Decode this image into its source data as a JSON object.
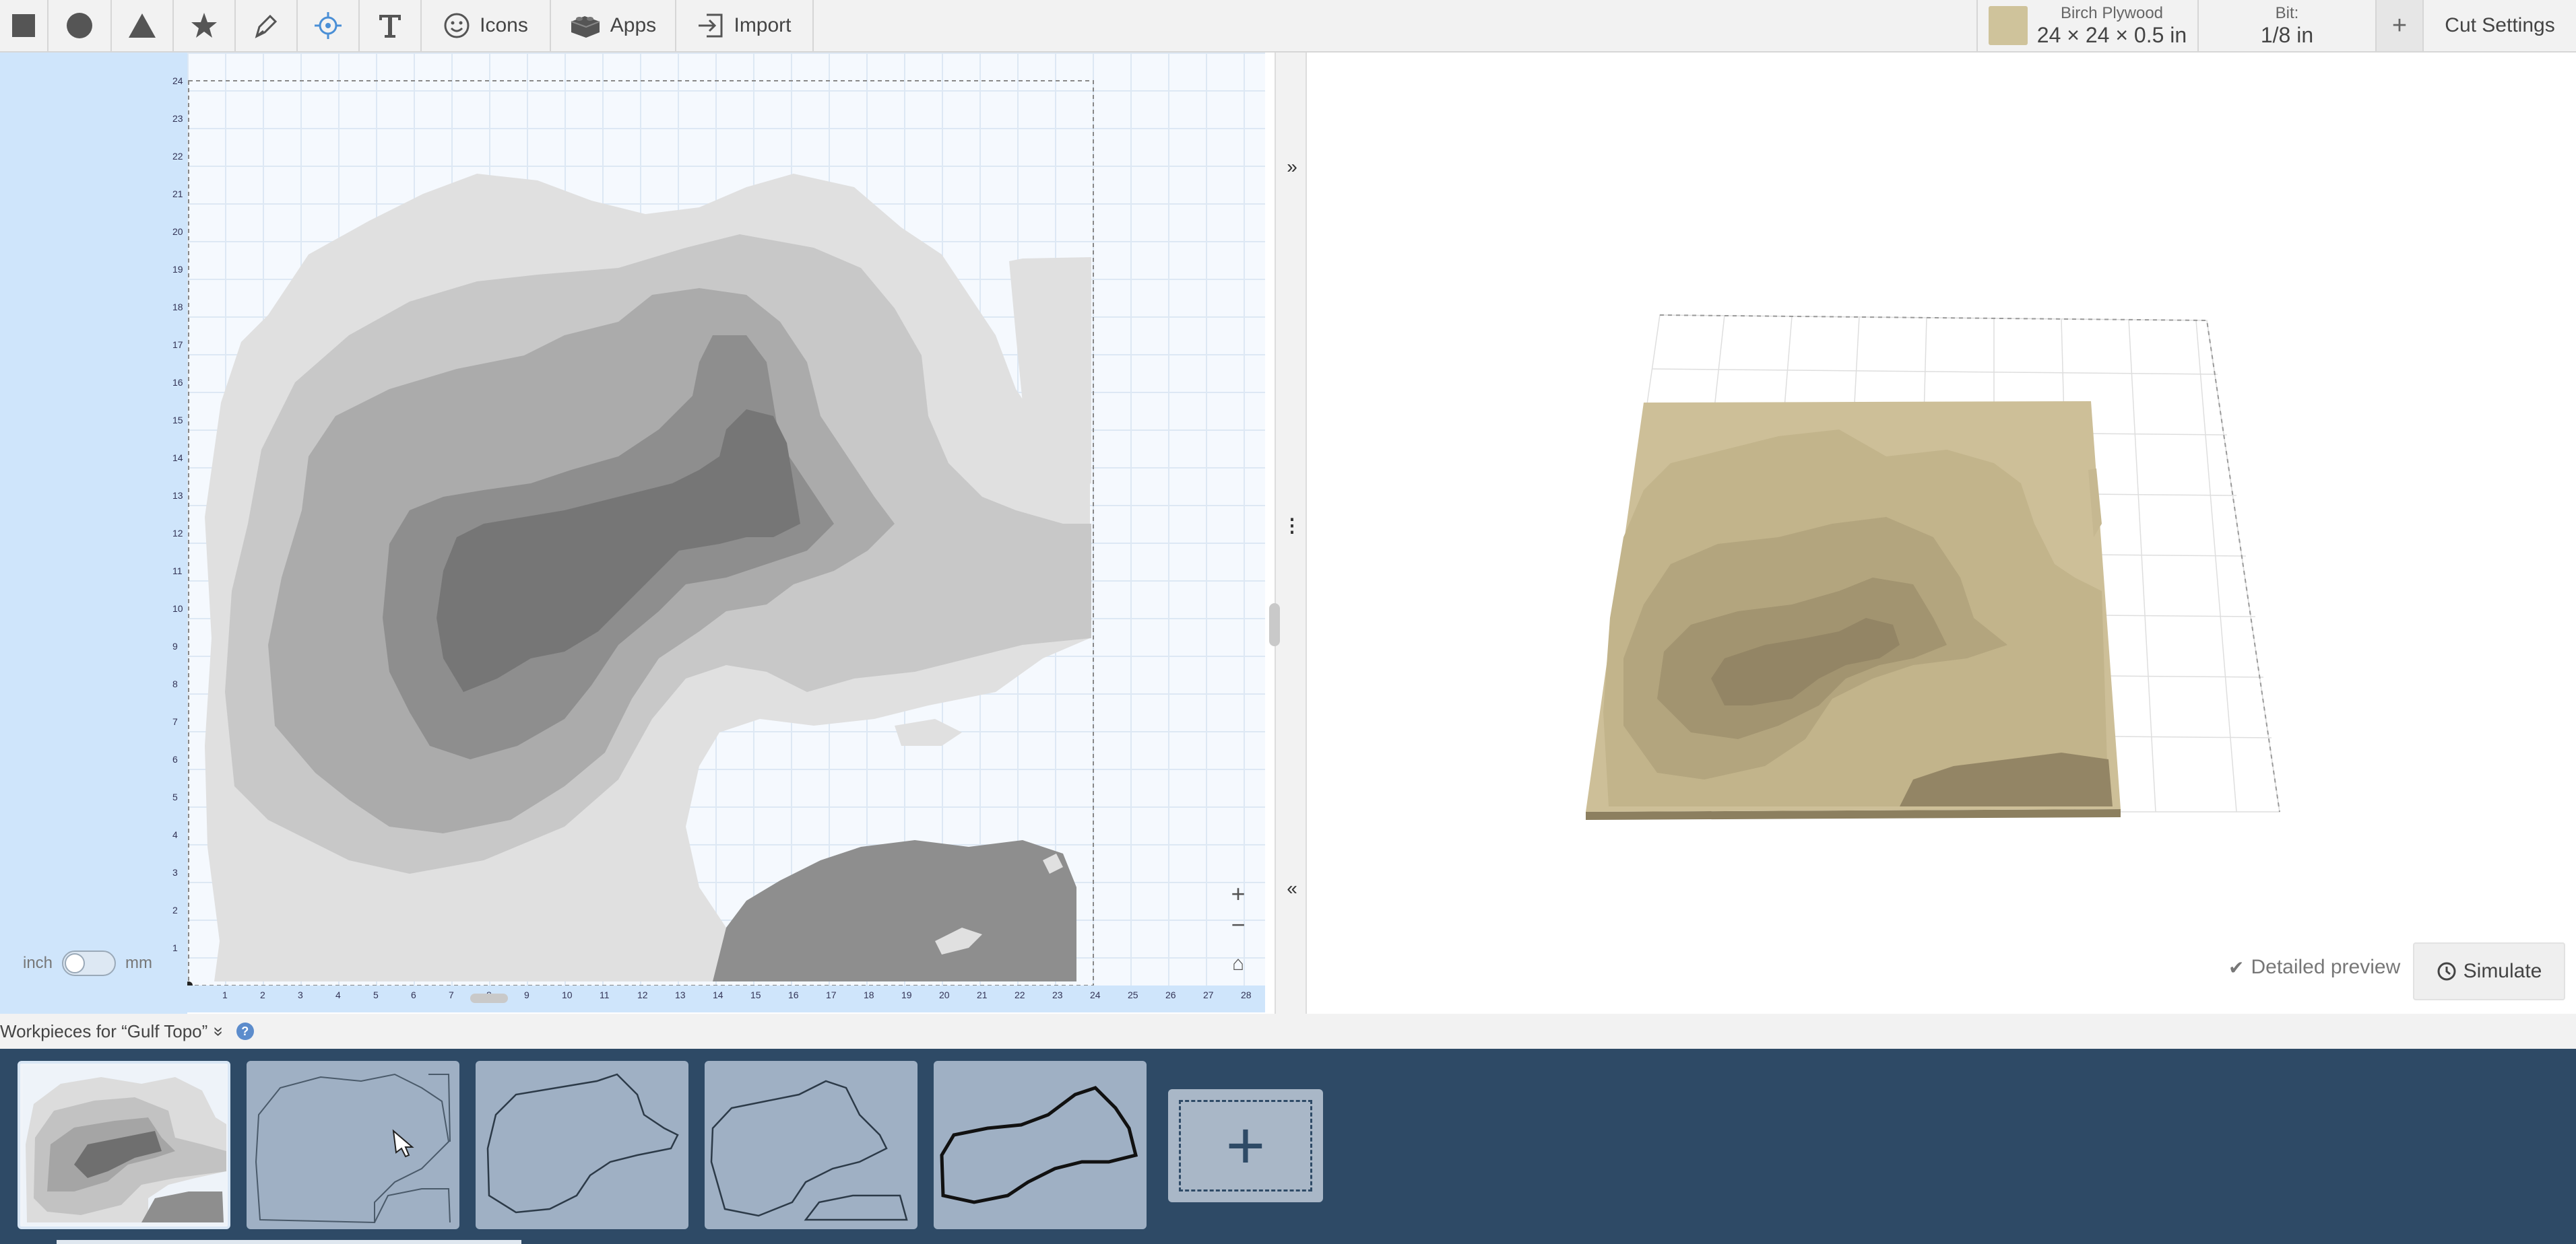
{
  "toolbar": {
    "tools": [
      {
        "name": "square-shape-tool",
        "icon": "square-icon"
      },
      {
        "name": "circle-shape-tool",
        "icon": "circle-icon"
      },
      {
        "name": "triangle-shape-tool",
        "icon": "triangle-icon"
      },
      {
        "name": "star-shape-tool",
        "icon": "star-icon"
      },
      {
        "name": "pen-tool",
        "icon": "pen-icon"
      },
      {
        "name": "point-tool",
        "icon": "crosshair-icon"
      },
      {
        "name": "text-tool",
        "icon": "text-icon"
      }
    ],
    "icons_label": "Icons",
    "apps_label": "Apps",
    "import_label": "Import",
    "material": {
      "name": "Birch Plywood",
      "size": "24 × 24 × 0.5 in",
      "swatch_color": "#cfc39b"
    },
    "bit": {
      "label": "Bit:",
      "value": "1/8 in"
    },
    "add_label": "+",
    "cut_settings_label": "Cut Settings"
  },
  "canvas": {
    "y_ruler": [
      "24",
      "23",
      "22",
      "21",
      "20",
      "19",
      "18",
      "17",
      "16",
      "15",
      "14",
      "13",
      "12",
      "11",
      "10",
      "9",
      "8",
      "7",
      "6",
      "5",
      "4",
      "3",
      "2",
      "1"
    ],
    "x_ruler": [
      "1",
      "2",
      "3",
      "4",
      "5",
      "6",
      "7",
      "8",
      "9",
      "10",
      "11",
      "12",
      "13",
      "14",
      "15",
      "16",
      "17",
      "18",
      "19",
      "20",
      "21",
      "22",
      "23",
      "24",
      "25",
      "26",
      "27",
      "28"
    ],
    "unit_left": "inch",
    "unit_right": "mm",
    "zoom_in": "+",
    "zoom_out": "−",
    "home": "⌂"
  },
  "splitter": {
    "collapse_right": "»",
    "menu": "⋮",
    "collapse_left": "«"
  },
  "preview": {
    "detailed_preview_label": "Detailed preview",
    "simulate_label": "Simulate"
  },
  "workpieces": {
    "title": "Workpieces for “Gulf Topo”",
    "chevron": "»",
    "help": "?",
    "add_label": "+"
  },
  "colors": {
    "accent_blue": "#cfe5fb",
    "workpiece_bar": "#2e4a66",
    "wood": "#cfc39b",
    "topo_level_1": "#e0e0e0",
    "topo_level_2": "#c8c8c8",
    "topo_level_3": "#ababab",
    "topo_level_4": "#8e8e8e",
    "topo_level_5": "#767676"
  }
}
